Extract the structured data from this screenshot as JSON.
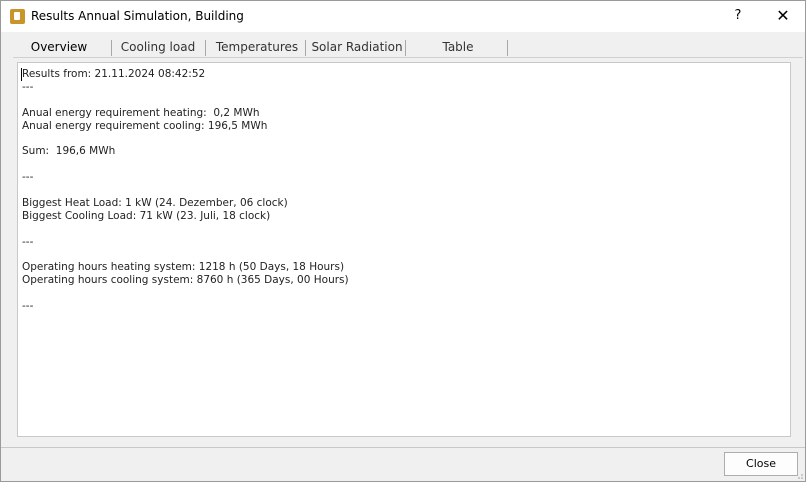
{
  "window": {
    "title": "Results Annual Simulation, Building",
    "help_label": "?",
    "close_label": "✕",
    "app_icon": "building-app-icon"
  },
  "tabs": [
    {
      "label": "Overview"
    },
    {
      "label": "Cooling load"
    },
    {
      "label": "Temperatures"
    },
    {
      "label": "Solar Radiation"
    },
    {
      "label": "Table"
    }
  ],
  "results": {
    "lines": [
      "Results from: 21.11.2024 08:42:52",
      "---",
      "",
      "Anual energy requirement heating:  0,2 MWh",
      "Anual energy requirement cooling: 196,5 MWh",
      "",
      "Sum:  196,6 MWh",
      "",
      "---",
      "",
      "Biggest Heat Load: 1 kW (24. Dezember, 06 clock)",
      "Biggest Cooling Load: 71 kW (23. Juli, 18 clock)",
      "",
      "---",
      "",
      "Operating hours heating system: 1218 h (50 Days, 18 Hours)",
      "Operating hours cooling system: 8760 h (365 Days, 00 Hours)",
      "",
      "---"
    ]
  },
  "footer": {
    "close_button_label": "Close"
  }
}
